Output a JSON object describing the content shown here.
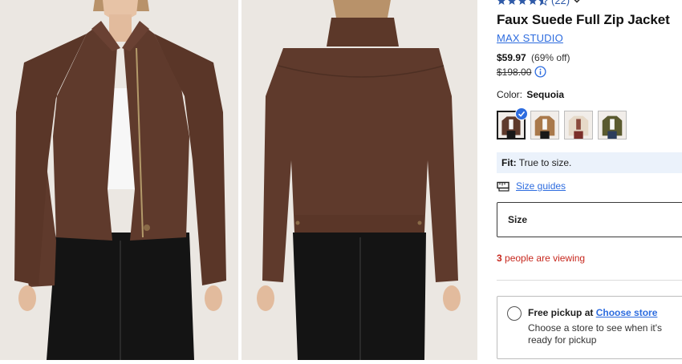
{
  "product": {
    "rating": 4.5,
    "rating_count": "(22)",
    "title": "Faux Suede Full Zip Jacket",
    "brand": "MAX STUDIO",
    "price": "$59.97",
    "discount": "(69% off)",
    "original_price": "$198.00",
    "color_label": "Color:",
    "color_value": "Sequoia",
    "swatches": [
      {
        "name": "Sequoia",
        "jacket": "#5e3a2c",
        "selected": true
      },
      {
        "name": "Tan",
        "jacket": "#a9794b",
        "selected": false
      },
      {
        "name": "Cream",
        "jacket": "#e6d9c8",
        "selected": false
      },
      {
        "name": "Olive",
        "jacket": "#5a5a2f",
        "selected": false
      }
    ],
    "fit_label": "Fit:",
    "fit_value": "True to size.",
    "size_guides_label": "Size guides",
    "size_label": "Size",
    "viewing_count": "3",
    "viewing_text": "people are viewing",
    "pickup_title": "Free pickup at",
    "pickup_link": "Choose store",
    "pickup_desc": "Choose a store to see when it's ready for pickup"
  },
  "colors": {
    "accent": "#2d6cdf",
    "alert": "#c7281e",
    "star": "#2f5aa8",
    "fit_bg": "#ebf2fb",
    "jacket": "#6a3f30"
  },
  "icons": {
    "star": "star-icon",
    "chevron": "chevron-down-icon",
    "info": "info-icon",
    "check": "check-icon",
    "ruler": "ruler-icon"
  }
}
